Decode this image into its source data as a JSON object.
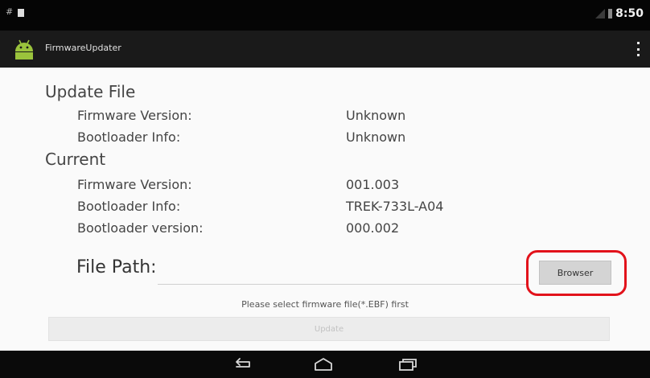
{
  "status_bar": {
    "left_glyph": "#",
    "time": "8:50"
  },
  "action_bar": {
    "title": "FirmwareUpdater",
    "app_icon": "android-icon",
    "overflow_icon": "overflow-menu-icon"
  },
  "update_file": {
    "heading": "Update File",
    "rows": [
      {
        "label": "Firmware Version:",
        "value": "Unknown"
      },
      {
        "label": "Bootloader Info:",
        "value": "Unknown"
      }
    ]
  },
  "current": {
    "heading": "Current",
    "rows": [
      {
        "label": "Firmware Version:",
        "value": "001.003"
      },
      {
        "label": "Bootloader Info:",
        "value": "TREK-733L-A04"
      },
      {
        "label": "Bootloader version:",
        "value": "000.002"
      }
    ]
  },
  "file_path": {
    "label": "File Path:",
    "value": "",
    "browse_label": "Browser"
  },
  "hint": "Please select firmware file(*.EBF) first",
  "update_label": "Update",
  "colors": {
    "highlight": "#e2121b",
    "android_green": "#9ac33c"
  },
  "nav_bar": {
    "icons": [
      "back-icon",
      "home-icon",
      "recents-icon"
    ]
  }
}
